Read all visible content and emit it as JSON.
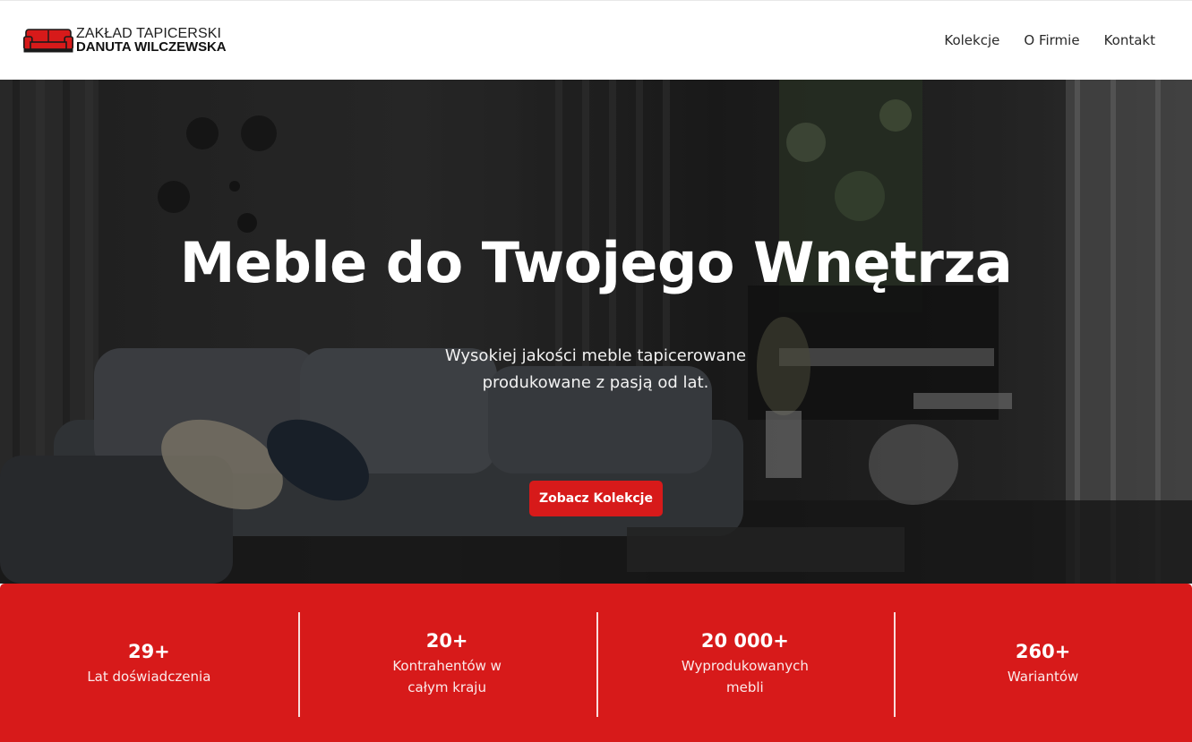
{
  "brand": {
    "line1": "ZAKŁAD TAPICERSKI",
    "line2": "DANUTA WILCZEWSKA",
    "logo_icon": "sofa-icon",
    "logo_color": "#d71a1a"
  },
  "nav": {
    "items": [
      {
        "label": "Kolekcje"
      },
      {
        "label": "O Firmie"
      },
      {
        "label": "Kontakt"
      }
    ]
  },
  "hero": {
    "title": "Meble do Twojego Wnętrza",
    "subtitle": "Wysokiej jakości meble tapicerowane produkowane z pasją od lat.",
    "cta_label": "Zobacz Kolekcje",
    "cta_color": "#d71a1a"
  },
  "stats": {
    "background": "#d71a1a",
    "items": [
      {
        "value": "29+",
        "label": "Lat doświadczenia"
      },
      {
        "value": "20+",
        "label": "Kontrahentów w całym kraju"
      },
      {
        "value": "20 000+",
        "label": "Wyprodukowanych mebli"
      },
      {
        "value": "260+",
        "label": "Wariantów"
      }
    ]
  }
}
